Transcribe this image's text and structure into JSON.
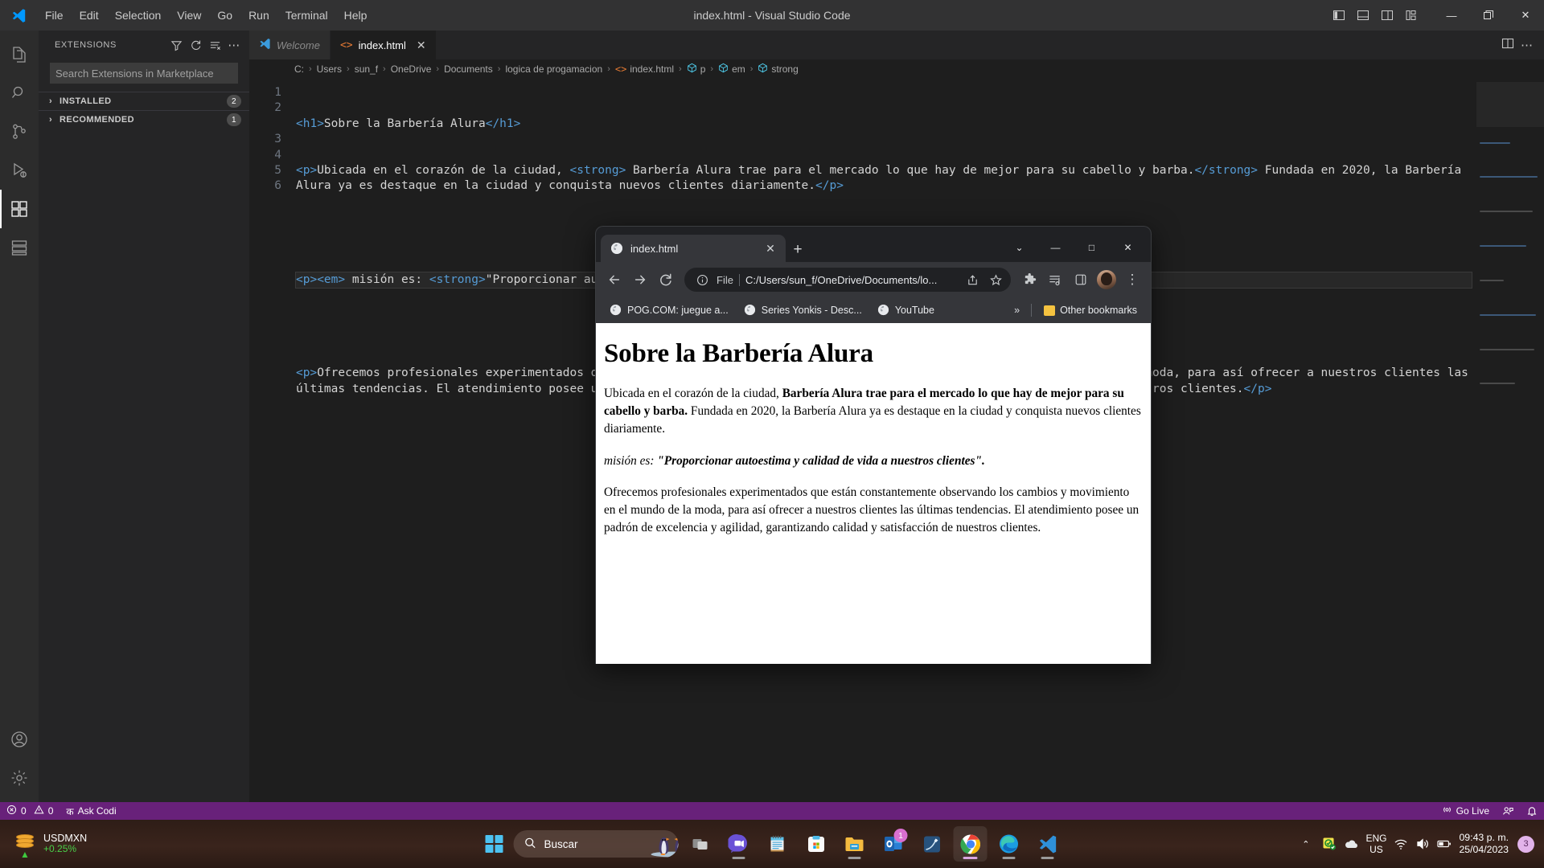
{
  "vscode": {
    "window_title": "index.html - Visual Studio Code",
    "menu": [
      "File",
      "Edit",
      "Selection",
      "View",
      "Go",
      "Run",
      "Terminal",
      "Help"
    ],
    "window_controls": {
      "minimize": "—",
      "maximize": "❐",
      "close": "✕"
    },
    "sidebar": {
      "title": "EXTENSIONS",
      "search_placeholder": "Search Extensions in Marketplace",
      "search_value": "",
      "sections": [
        {
          "label": "INSTALLED",
          "count": "2",
          "chevron": "›"
        },
        {
          "label": "RECOMMENDED",
          "count": "1",
          "chevron": "›"
        }
      ],
      "actions": [
        "filter-icon",
        "refresh-icon",
        "clear-search-icon",
        "more-actions-icon"
      ]
    },
    "activity_items": [
      "explorer-icon",
      "search-icon",
      "source-control-icon",
      "run-debug-icon",
      "extensions-icon",
      "remote-explorer-icon",
      "account-icon",
      "manage-settings-icon"
    ],
    "tabs": [
      {
        "label": "Welcome",
        "icon": "vscode-logo-icon",
        "active": false,
        "italic": true
      },
      {
        "label": "index.html",
        "icon": "html-icon",
        "active": true,
        "italic": false,
        "close": "✕"
      }
    ],
    "breadcrumb": [
      "C:",
      "Users",
      "sun_f",
      "OneDrive",
      "Documents",
      "logica de progamacion",
      "index.html",
      "p",
      "em",
      "strong"
    ],
    "code_lines": [
      {
        "n": "1",
        "active": false,
        "wrapped": false
      },
      {
        "n": "2",
        "active": false,
        "wrapped": false
      },
      {
        "n": "3",
        "active": false,
        "wrapped": false
      },
      {
        "n": "4",
        "active": true,
        "wrapped": false
      },
      {
        "n": "5",
        "active": false,
        "wrapped": false
      },
      {
        "n": "6",
        "active": false,
        "wrapped": false
      }
    ],
    "code": {
      "line1": "<h1>Sobre la Barbería Alura</h1>",
      "line2": "<p>Ubicada en el corazón de la ciudad, <strong> Barbería Alura trae para el mercado lo que hay de mejor para su cabello y barba.</strong> Fundada en 2020, la Barbería Alura ya es destaque en la ciudad y conquista nuevos clientes diariamente.</p>",
      "line3": "",
      "line4": "<p><em> misión es: <strong>\"Proporcionar autoestima y calidad de vida a nuestros clientes\".</strong></em></p>",
      "line5": "",
      "line6": "<p>Ofrecemos profesionales experimentados que están constantemente observando los cambios y movimiento en el mundo de la moda, para así ofrecer a nuestros clientes las últimas tendencias. El atendimiento posee un padrón de excelencia y agilidad, garantizando calidad y satisfacción de nuestros clientes.</p>"
    },
    "statusbar": {
      "errors": "0",
      "warnings": "0",
      "ask_codi": "Ask Codi",
      "go_live": "Go Live"
    }
  },
  "chrome": {
    "tab": {
      "title": "index.html",
      "close": "✕"
    },
    "new_tab": "+",
    "window_controls": {
      "more": "⌄",
      "minimize": "—",
      "maximize": "□",
      "close": "✕"
    },
    "toolbar": {
      "back": "←",
      "forward": "→",
      "reload": "↻",
      "file_label": "File",
      "url": "C:/Users/sun_f/OneDrive/Documents/lo...",
      "share_icon": "share-icon",
      "bookmark_icon": "star-icon",
      "extensions_icon": "puzzle-icon",
      "reading_list_icon": "reading-list-icon",
      "side_panel_icon": "side-panel-icon",
      "profile_icon": "avatar-icon",
      "menu_icon": "⋮"
    },
    "bookmarks": [
      {
        "label": "POG.COM: juegue a..."
      },
      {
        "label": "Series Yonkis - Desc..."
      },
      {
        "label": "YouTube"
      }
    ],
    "bookmarks_overflow": "»",
    "other_bookmarks": "Other bookmarks",
    "page": {
      "h1": "Sobre la Barbería Alura",
      "p1_pre": "Ubicada en el corazón de la ciudad, ",
      "p1_strong": "Barbería Alura trae para el mercado lo que hay de mejor para su cabello y barba.",
      "p1_post": " Fundada en 2020, la Barbería Alura ya es destaque en la ciudad y conquista nuevos clientes diariamente.",
      "p2_em": "misión es: ",
      "p2_strong": "\"Proporcionar autoestima y calidad de vida a nuestros clientes\".",
      "p3": "Ofrecemos profesionales experimentados que están constantemente observando los cambios y movimiento en el mundo de la moda, para así ofrecer a nuestros clientes las últimas tendencias. El atendimiento posee un padrón de excelencia y agilidad, garantizando calidad y satisfacción de nuestros clientes."
    }
  },
  "taskbar": {
    "widget": {
      "symbol": "USDMXN",
      "change": "+0.25%",
      "trend_icon": "trend-up-icon"
    },
    "search_placeholder": "Buscar",
    "apps": [
      {
        "name": "task-view-icon",
        "badge": ""
      },
      {
        "name": "teams-icon",
        "badge": ""
      },
      {
        "name": "notepad-icon",
        "badge": ""
      },
      {
        "name": "microsoft-store-icon",
        "badge": ""
      },
      {
        "name": "file-explorer-icon",
        "badge": ""
      },
      {
        "name": "outlook-icon",
        "badge": "1"
      },
      {
        "name": "ms-paint-icon",
        "badge": ""
      },
      {
        "name": "chrome-icon",
        "badge": ""
      },
      {
        "name": "edge-icon",
        "badge": ""
      },
      {
        "name": "vscode-icon",
        "badge": ""
      }
    ],
    "tray": {
      "chevron": "⌃",
      "language_line1": "ENG",
      "language_line2": "US",
      "time": "09:43 p. m.",
      "date": "25/04/2023",
      "notification_count": "3"
    }
  },
  "colors": {
    "vscode_bg": "#1e1e1e",
    "sidebar_bg": "#252526",
    "statusbar": "#68217a",
    "accent_blue": "#569cd6",
    "taskbar": "#2e1d17"
  }
}
